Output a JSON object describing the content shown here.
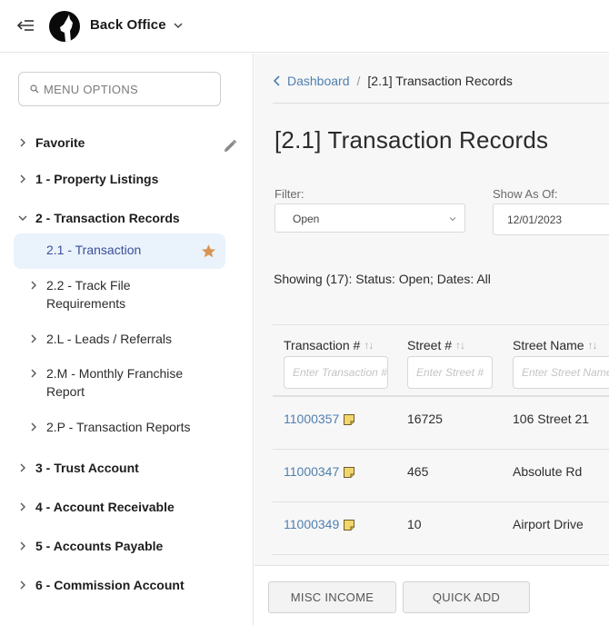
{
  "header": {
    "app_title": "Back Office",
    "logo": "wolf-logo-icon",
    "collapse_icon": "collapse-menu-icon",
    "app_menu_icon": "chevron-down-icon"
  },
  "sidebar": {
    "search_placeholder": "MENU OPTIONS",
    "favorite": {
      "label": "Favorite",
      "edit_icon": "pencil-icon"
    },
    "sections": [
      {
        "label": "1 - Property Listings",
        "expanded": false
      },
      {
        "label": "2 - Transaction Records",
        "expanded": true,
        "children": [
          {
            "label": "2.1 - Transaction",
            "active": true,
            "favorite": true
          },
          {
            "label": "2.2 - Track File Requirements"
          },
          {
            "label": "2.L - Leads / Referrals"
          },
          {
            "label": "2.M - Monthly Franchise Report"
          },
          {
            "label": "2.P - Transaction Reports"
          }
        ]
      },
      {
        "label": "3 - Trust Account",
        "expanded": false
      },
      {
        "label": "4 - Account Receivable",
        "expanded": false
      },
      {
        "label": "5 - Accounts Payable",
        "expanded": false
      },
      {
        "label": "6 - Commission Account",
        "expanded": false
      }
    ],
    "sub_22_line1": "2.2 - Track File",
    "sub_22_line2": "Requirements",
    "sub_2m_line1": "2.M - Monthly Franchise",
    "sub_2m_line2": "Report"
  },
  "main": {
    "breadcrumb": {
      "back_label": "Dashboard",
      "separator": "/",
      "current": "[2.1] Transaction Records"
    },
    "title": "[2.1] Transaction Records",
    "filter": {
      "label": "Filter:",
      "value": "Open"
    },
    "show_as_of": {
      "label": "Show As Of:",
      "value": "12/01/2023"
    },
    "showing_text": "Showing (17): Status: Open; Dates: All",
    "table": {
      "sort_glyph": "↑↓",
      "columns": [
        {
          "label": "Transaction #",
          "placeholder": "Enter Transaction #"
        },
        {
          "label": "Street #",
          "placeholder": "Enter Street #"
        },
        {
          "label": "Street Name",
          "placeholder": "Enter Street Name"
        }
      ],
      "rows": [
        {
          "transaction": "11000357",
          "street_no": "16725",
          "street_name": "106 Street 21",
          "has_note": true
        },
        {
          "transaction": "11000347",
          "street_no": "465",
          "street_name": "Absolute Rd",
          "has_note": true
        },
        {
          "transaction": "11000349",
          "street_no": "10",
          "street_name": "Airport Drive",
          "has_note": true
        }
      ]
    },
    "buttons": {
      "misc_income": "MISC INCOME",
      "quick_add": "QUICK ADD"
    }
  },
  "colors": {
    "accent_link": "#4f7fb0",
    "active_bg": "#eaf2fb",
    "active_text": "#3b4f9a",
    "star": "#d99550",
    "note": "#f3d66b"
  }
}
